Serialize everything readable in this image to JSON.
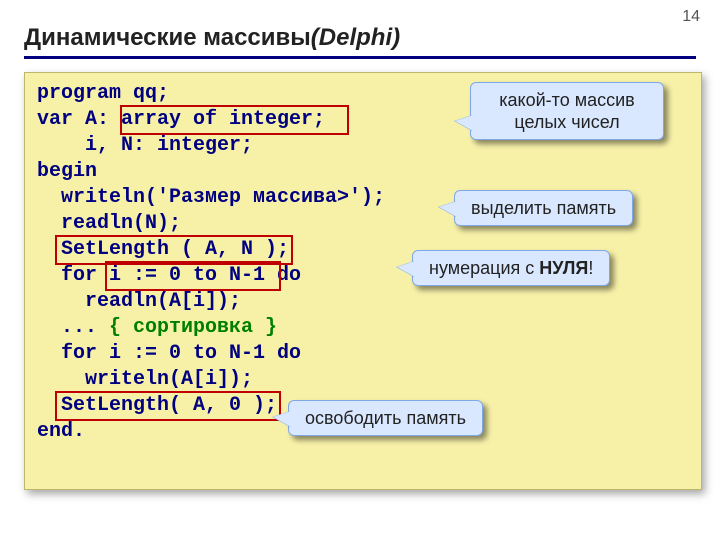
{
  "page_number": "14",
  "title_main": "Динамические массивы",
  "title_ital": "(Delphi)",
  "code": {
    "l1": "program qq;",
    "l2a": "var A: ",
    "l2b": "array of integer;",
    "l3": "    i, N: integer;",
    "l4": "begin",
    "l5": "  writeln('Размер массива>');",
    "l6": "  readln(N);",
    "l7": "  SetLength ( A, N );",
    "l8a": "  for ",
    "l8b": "i := 0 to N-1",
    "l8c": " do",
    "l9": "    readln(A[i]);",
    "l10a": "  ... ",
    "l10b": "{ сортировка }",
    "l11": "  for i := 0 to N-1 do",
    "l12": "    writeln(A[i]);",
    "l13": "  SetLength( A, 0 );",
    "l14": "end."
  },
  "callouts": {
    "c1a": "какой-то массив",
    "c1b": "целых чисел",
    "c2": "выделить память",
    "c3a": "нумерация с ",
    "c3b": "НУЛЯ",
    "c3c": "!",
    "c4": "освободить память"
  }
}
